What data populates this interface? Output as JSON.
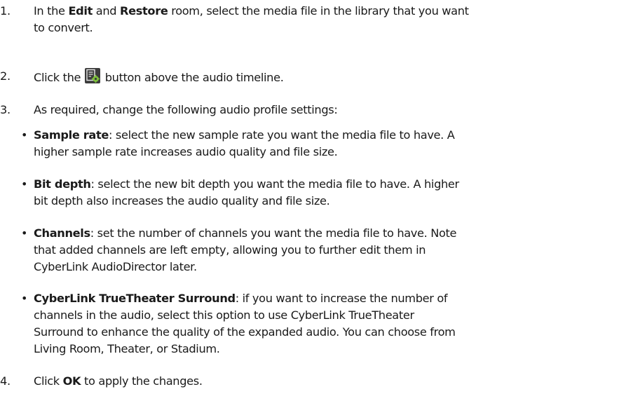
{
  "steps": [
    {
      "num": "1.",
      "t0": "In the ",
      "b0": "Edit",
      "t1": " and ",
      "b1": "Restore",
      "t2": " room, select the media file in the library that you want",
      "line2": "to convert."
    },
    {
      "num": "2.",
      "t0": "Click the ",
      "icon": "audio-profile-settings-icon",
      "t1": " button above the audio timeline."
    },
    {
      "num": "3.",
      "t0": "As required, change the following audio profile settings:"
    },
    {
      "num": "4.",
      "t0": "Click ",
      "b0": "OK",
      "t1": " to apply the changes."
    }
  ],
  "bullets": [
    {
      "dot": "•",
      "label": "Sample rate",
      "line1": ": select the new sample rate you want the media file to have. A",
      "line2": "higher sample rate increases audio quality and file size."
    },
    {
      "dot": "•",
      "label": "Bit depth",
      "line1": ": select the new bit depth you want the media file to have. A higher",
      "line2": "bit depth also increases the audio quality and file size."
    },
    {
      "dot": "•",
      "label": "Channels",
      "line1": ": set the number of channels you want the media file to have. Note",
      "line2": "that added channels are left empty, allowing you to further edit them in",
      "line3": "CyberLink AudioDirector later."
    },
    {
      "dot": "•",
      "label": "CyberLink TrueTheater Surround",
      "line1": ": if you want to increase the number of",
      "line2": "channels in the audio, select this option to use CyberLink TrueTheater",
      "line3": "Surround to enhance the quality of the expanded audio. You can choose from",
      "line4": "Living Room, Theater, or Stadium."
    }
  ],
  "colors": {
    "text": "#1a1a1a",
    "icon_bg": "#3c3c3c",
    "icon_fg": "#e6e6e6",
    "icon_gear": "#7ec23a"
  }
}
